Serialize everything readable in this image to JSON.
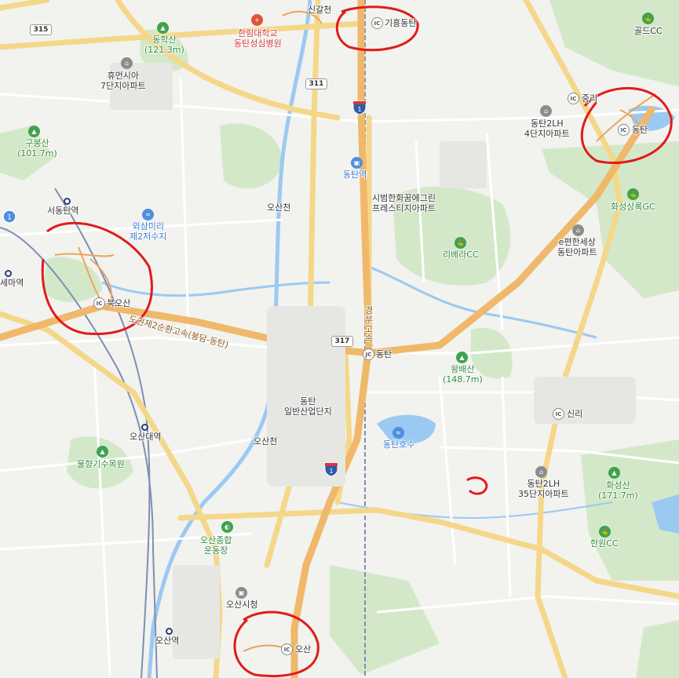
{
  "map": {
    "labels": {
      "singal": "신갈천",
      "hallym_hospital": "한림대학교\n동탄성심병원",
      "gihung_dongtan": "기흥동탄",
      "donghaksan": "동학산\n(121.3m)",
      "humansia": "휴먼시아\n7단지아파트",
      "golf_cc": "골드CC",
      "jungni": "중리",
      "dongtan2lh4": "동탄2LH\n4단지아파트",
      "dongtan_ic": "동탄",
      "gubongsan": "구봉산\n(101.7m)",
      "seodongtan": "서동탄역",
      "oesammiri": "외삼미리\n제2저수지",
      "osancheon_top": "오산천",
      "dongtan_station": "동탄역",
      "sibeom": "시범한화꿈에그린\n프레스티지아파트",
      "hwaseong_sangnok": "화성상록GC",
      "riviera": "리베라CC",
      "epyeonhan": "e편한세상\n동탄아파트",
      "semayeok": "세마역",
      "bukosan": "북오산",
      "expressway": "도권제2순환고속(봉담-동탄)",
      "gyeongbu": "경부고속",
      "dongtan_jc": "동탄",
      "wangbaesan": "왕배산\n(148.7m)",
      "industrial": "동탄\n일반산업단지",
      "sinri": "신리",
      "osandae": "오산대역",
      "osancheon_mid": "오산천",
      "dongtan_lake": "동탄호수",
      "mulhyanggi": "물향기수목원",
      "dongtan2lh35": "동탄2LH\n35단지아파트",
      "hwaseongsan": "화성산\n(171.7m)",
      "hanwon": "한원CC",
      "osan_stadium": "오산종합\n운동장",
      "osan_cityhall": "오산시청",
      "osan_station": "오산역",
      "osan_ic": "오산"
    },
    "road_numbers": {
      "r315": "315",
      "r311": "311",
      "r317": "317",
      "hwy1": "1"
    },
    "icon_glyphs": {
      "ic": "IC",
      "jc": "JC",
      "mountain": "▲",
      "apartment": "⌂",
      "hospital": "+",
      "golf": "⛳",
      "water": "≈",
      "stadium": "◐",
      "building": "▣"
    },
    "colors": {
      "background": "#f2f2ef",
      "green_area": "#cfe6c4",
      "water": "#9cc9f2",
      "major_road": "#f5c979",
      "expressway": "#f0b86a",
      "minor_road": "#ffffff",
      "rail": "#7d8fb3",
      "annotation": "#e01b1b"
    }
  }
}
